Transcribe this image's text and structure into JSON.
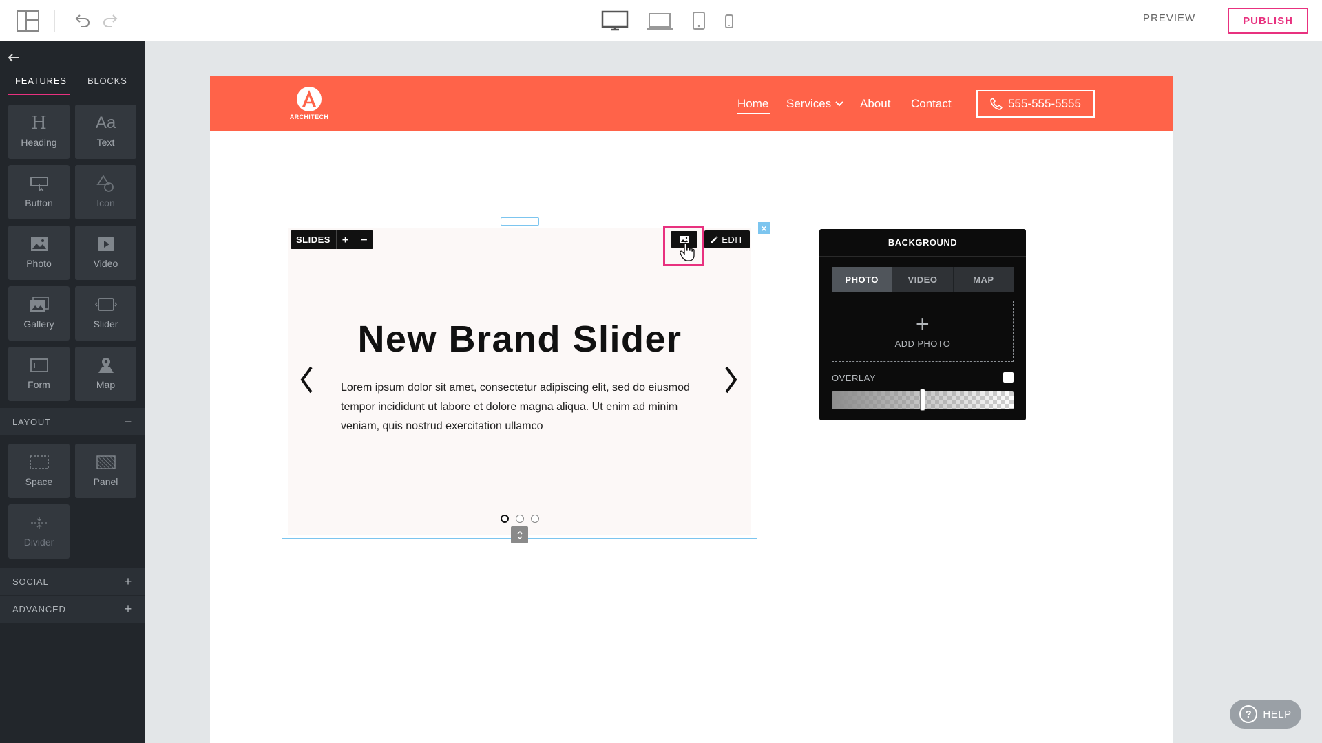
{
  "topbar": {
    "preview_label": "PREVIEW",
    "publish_label": "PUBLISH",
    "accent": "#e8317f"
  },
  "sidebar": {
    "tabs": [
      {
        "label": "FEATURES"
      },
      {
        "label": "BLOCKS"
      }
    ],
    "features": [
      {
        "label": "Heading",
        "icon": "heading-icon"
      },
      {
        "label": "Text",
        "icon": "text-icon"
      },
      {
        "label": "Button",
        "icon": "button-icon"
      },
      {
        "label": "Icon",
        "icon": "shapes-icon"
      },
      {
        "label": "Photo",
        "icon": "photo-icon"
      },
      {
        "label": "Video",
        "icon": "video-icon"
      },
      {
        "label": "Gallery",
        "icon": "gallery-icon"
      },
      {
        "label": "Slider",
        "icon": "slider-icon"
      },
      {
        "label": "Form",
        "icon": "form-icon"
      },
      {
        "label": "Map",
        "icon": "map-icon"
      }
    ],
    "layout_section": {
      "label": "LAYOUT",
      "sign": "−"
    },
    "layout_items": [
      {
        "label": "Space",
        "icon": "space-icon"
      },
      {
        "label": "Panel",
        "icon": "panel-icon"
      },
      {
        "label": "Divider",
        "icon": "divider-icon"
      }
    ],
    "social_section": {
      "label": "SOCIAL",
      "sign": "+"
    },
    "advanced_section": {
      "label": "ADVANCED",
      "sign": "+"
    }
  },
  "site": {
    "header_color": "#ff6349",
    "logo_text": "ARCHITECH",
    "nav": [
      {
        "label": "Home"
      },
      {
        "label": "Services"
      },
      {
        "label": "About"
      },
      {
        "label": "Contact"
      }
    ],
    "phone": "555-555-5555"
  },
  "slider": {
    "toolbar": {
      "slides_label": "SLIDES",
      "add": "+",
      "remove": "−",
      "edit_label": "EDIT"
    },
    "title": "New Brand Slider",
    "body": "Lorem ipsum dolor sit amet, consectetur adipiscing elit, sed do eiusmod tempor incididunt ut labore et dolore magna aliqua. Ut enim ad minim veniam, quis nostrud exercitation ullamco",
    "close": "×",
    "dots_count": 3,
    "active_dot": 1,
    "selection_color": "#7cc5ef"
  },
  "background_panel": {
    "title": "BACKGROUND",
    "tabs": [
      {
        "label": "PHOTO"
      },
      {
        "label": "VIDEO"
      },
      {
        "label": "MAP"
      }
    ],
    "active_tab": "PHOTO",
    "add_photo_label": "ADD PHOTO",
    "overlay_label": "OVERLAY",
    "overlay_value": 0.5
  },
  "help": {
    "label": "HELP"
  }
}
